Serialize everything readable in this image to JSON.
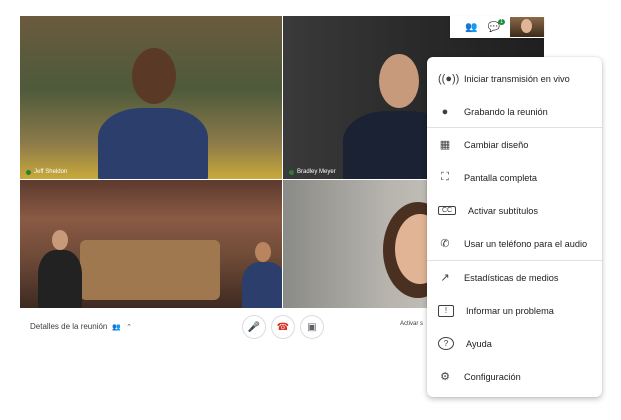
{
  "participants": [
    {
      "name": "Jeff Sheldon"
    },
    {
      "name": "Bradley Meyer"
    }
  ],
  "top_bar": {
    "people_icon": "people-icon",
    "chat_icon": "chat-icon",
    "chat_badge": "1"
  },
  "bottom_bar": {
    "meeting_details_label": "Detalles de la reunión",
    "mic_icon": "microphone-icon",
    "hangup_icon": "hangup-icon",
    "camera_icon": "camera-icon",
    "captions_peek": "Activar s"
  },
  "menu": {
    "items": [
      {
        "icon": "broadcast-icon",
        "label": "Iniciar transmisión en vivo"
      },
      {
        "icon": "record-dot-icon",
        "label": "Grabando la reunión"
      },
      {
        "icon": "grid-layout-icon",
        "label": "Cambiar diseño"
      },
      {
        "icon": "fullscreen-icon",
        "label": "Pantalla completa"
      },
      {
        "icon": "captions-icon",
        "label": "Activar subtítulos"
      },
      {
        "icon": "phone-audio-icon",
        "label": "Usar un teléfono para el audio"
      },
      {
        "icon": "stats-icon",
        "label": "Estadísticas de medios"
      },
      {
        "icon": "report-problem-icon",
        "label": "Informar un problema"
      },
      {
        "icon": "help-icon",
        "label": "Ayuda"
      },
      {
        "icon": "settings-icon",
        "label": "Configuración"
      }
    ]
  },
  "colors": {
    "accent_red": "#d93025",
    "mic_green": "#2e7d32",
    "text_dark": "#202124"
  }
}
